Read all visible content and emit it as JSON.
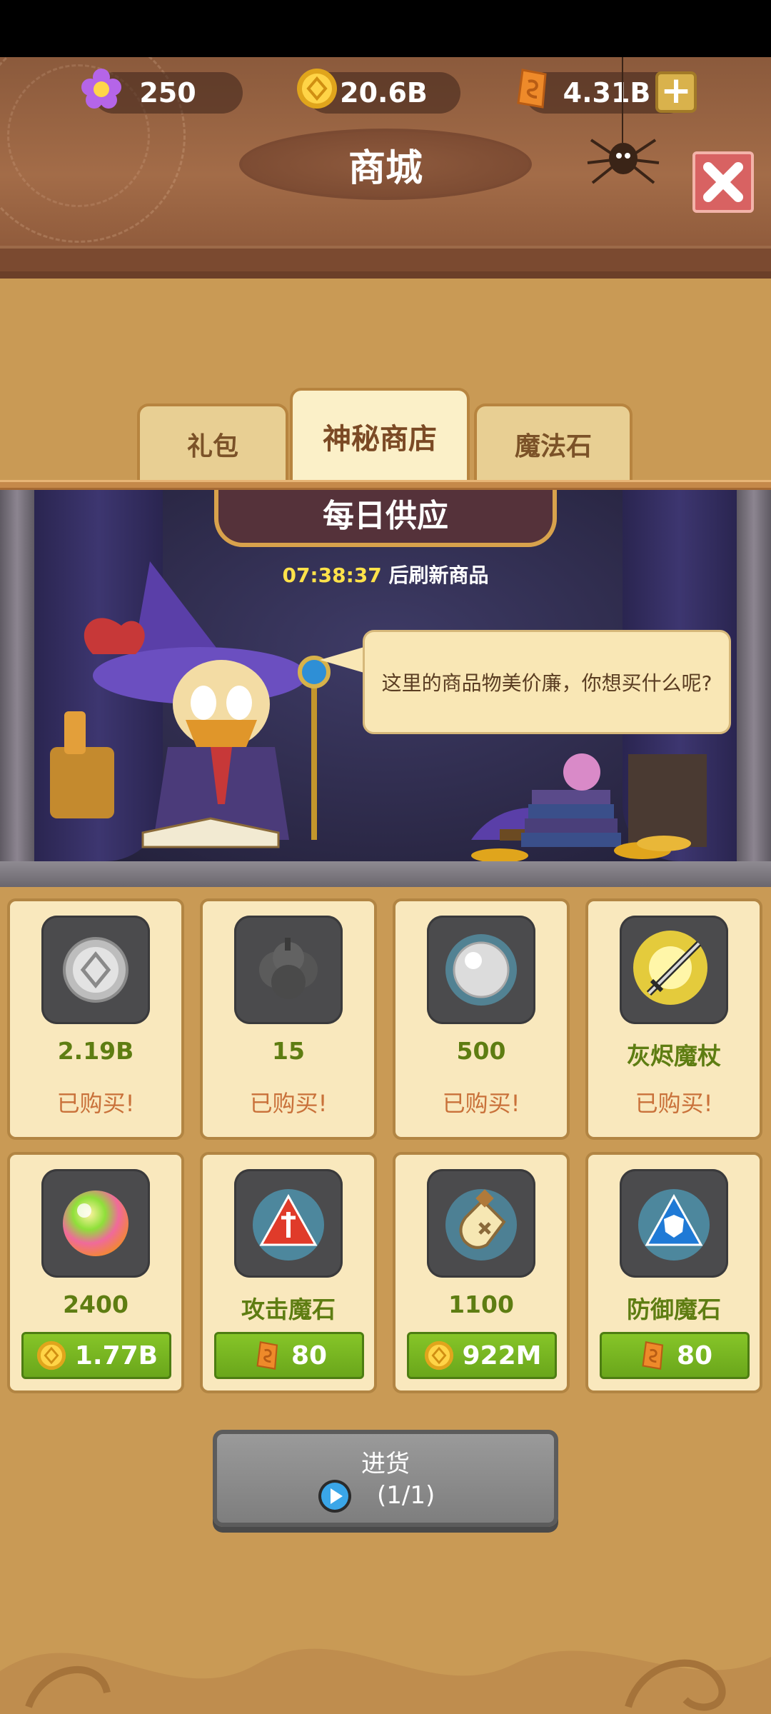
{
  "currencies": {
    "gems": "250",
    "gold": "20.6B",
    "runes": "4.31B"
  },
  "header": {
    "title": "商城"
  },
  "tabs": [
    {
      "label": "礼包"
    },
    {
      "label": "神秘商店"
    },
    {
      "label": "魔法石"
    }
  ],
  "shop": {
    "banner": "每日供应",
    "timer": "07:38:37",
    "timer_suffix": " 后刷新商品",
    "dialogue": "这里的商品物美价廉，你想买什么呢?"
  },
  "items": [
    {
      "name": "2.19B",
      "status": "已购买!",
      "icon": "silver-coin-icon"
    },
    {
      "name": "15",
      "status": "已购买!",
      "icon": "dark-ore-icon"
    },
    {
      "name": "500",
      "status": "已购买!",
      "icon": "pearl-icon"
    },
    {
      "name": "灰烬魔杖",
      "status": "已购买!",
      "icon": "wand-icon"
    },
    {
      "name": "2400",
      "price": "1.77B",
      "currency": "gold-coin-icon",
      "icon": "rainbow-orb-icon"
    },
    {
      "name": "攻击魔石",
      "price": "80",
      "currency": "rune-icon",
      "icon": "attack-stone-icon"
    },
    {
      "name": "1100",
      "price": "922M",
      "currency": "gold-coin-icon",
      "icon": "potion-bottle-icon"
    },
    {
      "name": "防御魔石",
      "price": "80",
      "currency": "rune-icon",
      "icon": "defense-stone-icon"
    }
  ],
  "restock": {
    "label": "进货",
    "count": "(1/1)"
  },
  "colors": {
    "header_brown": "#a36c48",
    "panel_tan": "#c99a55",
    "card_cream": "#f9e8bd",
    "price_green": "#6aa61b",
    "name_green": "#5e7d12",
    "bought_orange": "#c9713a"
  }
}
